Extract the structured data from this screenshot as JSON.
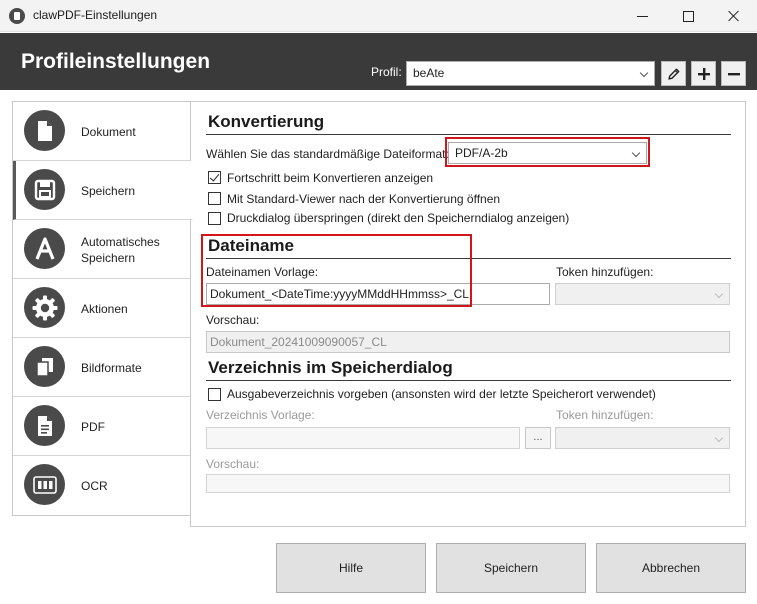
{
  "window": {
    "title": "clawPDF-Einstellungen"
  },
  "header": {
    "title": "Profileinstellungen",
    "profile_label": "Profil:",
    "profile_value": "beAte"
  },
  "nav": {
    "items": [
      {
        "label": "Dokument",
        "icon": "document-icon"
      },
      {
        "label": "Speichern",
        "icon": "save-icon",
        "active": true
      },
      {
        "label": "Automatisches Speichern",
        "icon": "auto-save-icon"
      },
      {
        "label": "Aktionen",
        "icon": "gear-icon"
      },
      {
        "label": "Bildformate",
        "icon": "image-formats-icon"
      },
      {
        "label": "PDF",
        "icon": "pdf-icon"
      },
      {
        "label": "OCR",
        "icon": "ocr-icon"
      }
    ]
  },
  "konvertierung": {
    "title": "Konvertierung",
    "format_label": "Wählen Sie das standardmäßige Dateiformat:",
    "format_value": "PDF/A-2b",
    "options": [
      {
        "label": "Fortschritt beim Konvertieren anzeigen",
        "checked": true
      },
      {
        "label": "Mit Standard-Viewer nach der Konvertierung öffnen",
        "checked": false
      },
      {
        "label": "Druckdialog überspringen (direkt den Speicherndialog anzeigen)",
        "checked": false
      }
    ]
  },
  "dateiname": {
    "title": "Dateiname",
    "template_label": "Dateinamen Vorlage:",
    "template_value": "Dokument_<DateTime:yyyyMMddHHmmss>_CL",
    "token_label": "Token hinzufügen:",
    "preview_label": "Vorschau:",
    "preview_value": "Dokument_20241009090057_CL"
  },
  "verzeichnis": {
    "title": "Verzeichnis im Speicherdialog",
    "option_label": "Ausgabeverzeichnis vorgeben (ansonsten wird der letzte Speicherort verwendet)",
    "option_checked": false,
    "template_label": "Verzeichnis Vorlage:",
    "browse_label": "...",
    "token_label": "Token hinzufügen:",
    "preview_label": "Vorschau:"
  },
  "buttons": {
    "help": "Hilfe",
    "save": "Speichern",
    "cancel": "Abbrechen"
  },
  "colors": {
    "header_bg": "#3a3a3a",
    "highlight": "#d0161b",
    "icon_circle": "#4a4a4a"
  }
}
